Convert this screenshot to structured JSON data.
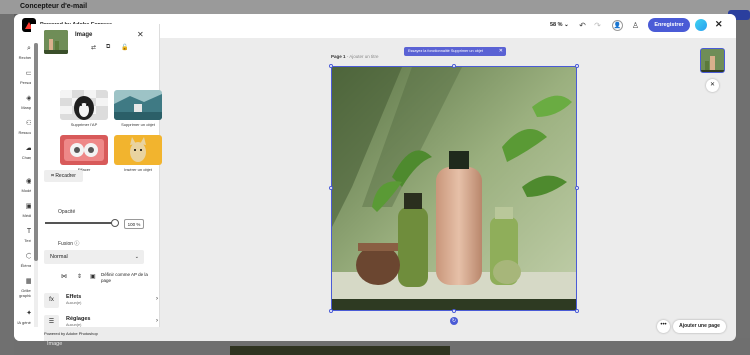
{
  "background": {
    "title": "Concepteur d'e-mail",
    "bottom_label": "Image"
  },
  "topbar": {
    "brand": "Powered by Adobe Express",
    "zoom": "58 %",
    "save_label": "Enregistrer"
  },
  "rail": {
    "items": [
      {
        "label": "Rechercher",
        "icon": "search-icon"
      },
      {
        "label": "Personnel",
        "icon": "folder-icon"
      },
      {
        "label": "Marques",
        "icon": "brand-icon"
      },
      {
        "label": "Ressources",
        "icon": "shapes-icon"
      },
      {
        "label": "Charger",
        "icon": "cloud-upload-icon"
      },
      {
        "label": "Modèles",
        "icon": "templates-icon"
      },
      {
        "label": "Médias",
        "icon": "media-icon"
      },
      {
        "label": "Texte",
        "icon": "text-icon"
      },
      {
        "label": "Éléments",
        "icon": "elements-icon"
      },
      {
        "label": "Grilles et graphiques",
        "icon": "grid-icon"
      },
      {
        "label": "IA générative",
        "icon": "ai-icon"
      }
    ]
  },
  "panel": {
    "title": "Image",
    "quick_actions": [
      {
        "label": "Supprimer l'AP"
      },
      {
        "label": "Supprimer un objet"
      },
      {
        "label": "Effacer"
      },
      {
        "label": "Insérer un objet"
      }
    ],
    "crop_label": "Recadrer",
    "opacity_label": "Opacité",
    "opacity_value": "100 %",
    "opacity_fraction": 1.0,
    "blend_label": "Fusion",
    "blend_value": "Normal",
    "define_bg_label": "Définir comme AP de la page",
    "effects": {
      "title": "Effets",
      "sub": "Aucun(e)"
    },
    "adjustments": {
      "title": "Réglages",
      "sub": "Aucun(e)"
    },
    "footer": "Powered by Adobe Photoshop"
  },
  "canvas": {
    "page_label": "Page 1",
    "page_sub": " - Ajouter un titre",
    "tip": "Essayez la fonctionnalité Supprimer un objet",
    "add_page": "Ajouter une page"
  }
}
